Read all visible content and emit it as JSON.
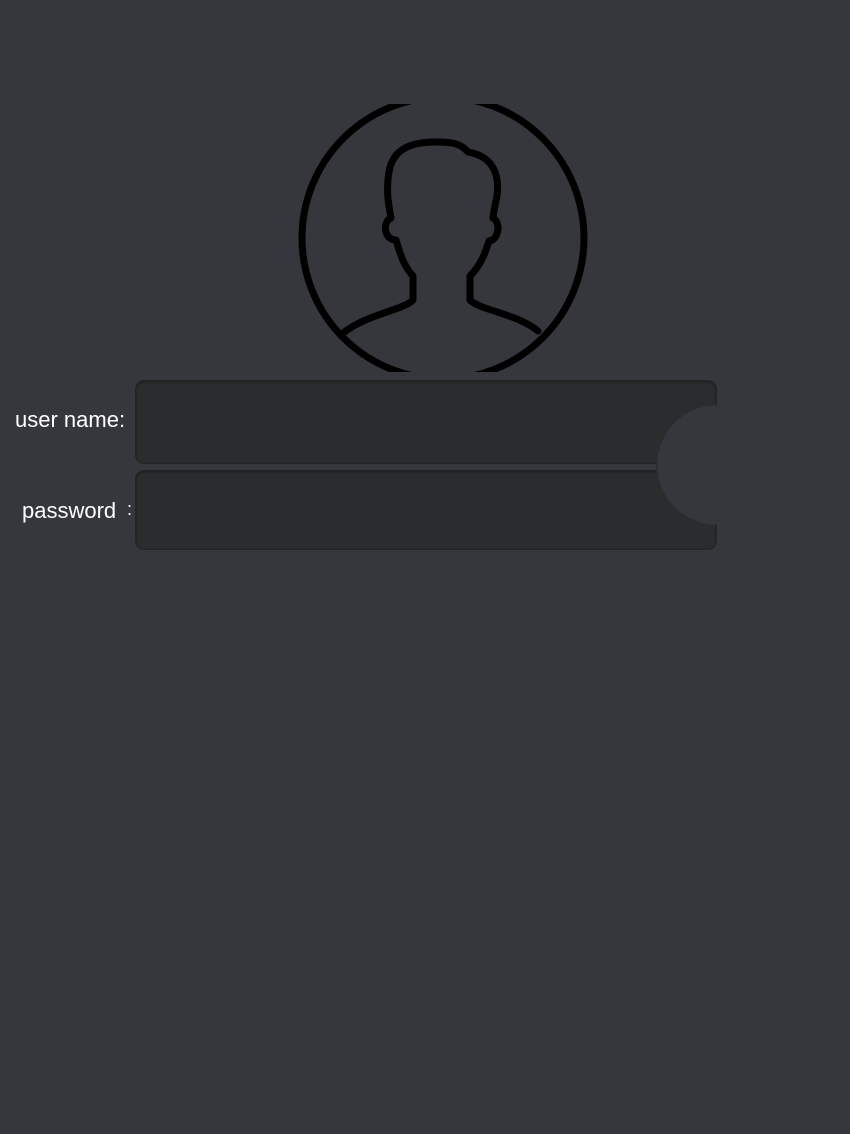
{
  "login": {
    "avatar_icon": "user-avatar-icon",
    "username_label": "user name:",
    "password_label": "password",
    "password_colon": ":",
    "username_value": "",
    "password_value": ""
  },
  "colors": {
    "background": "#35373c",
    "field_background": "#2b2c2e",
    "label_text": "#ffffff",
    "icon_stroke": "#000000"
  }
}
